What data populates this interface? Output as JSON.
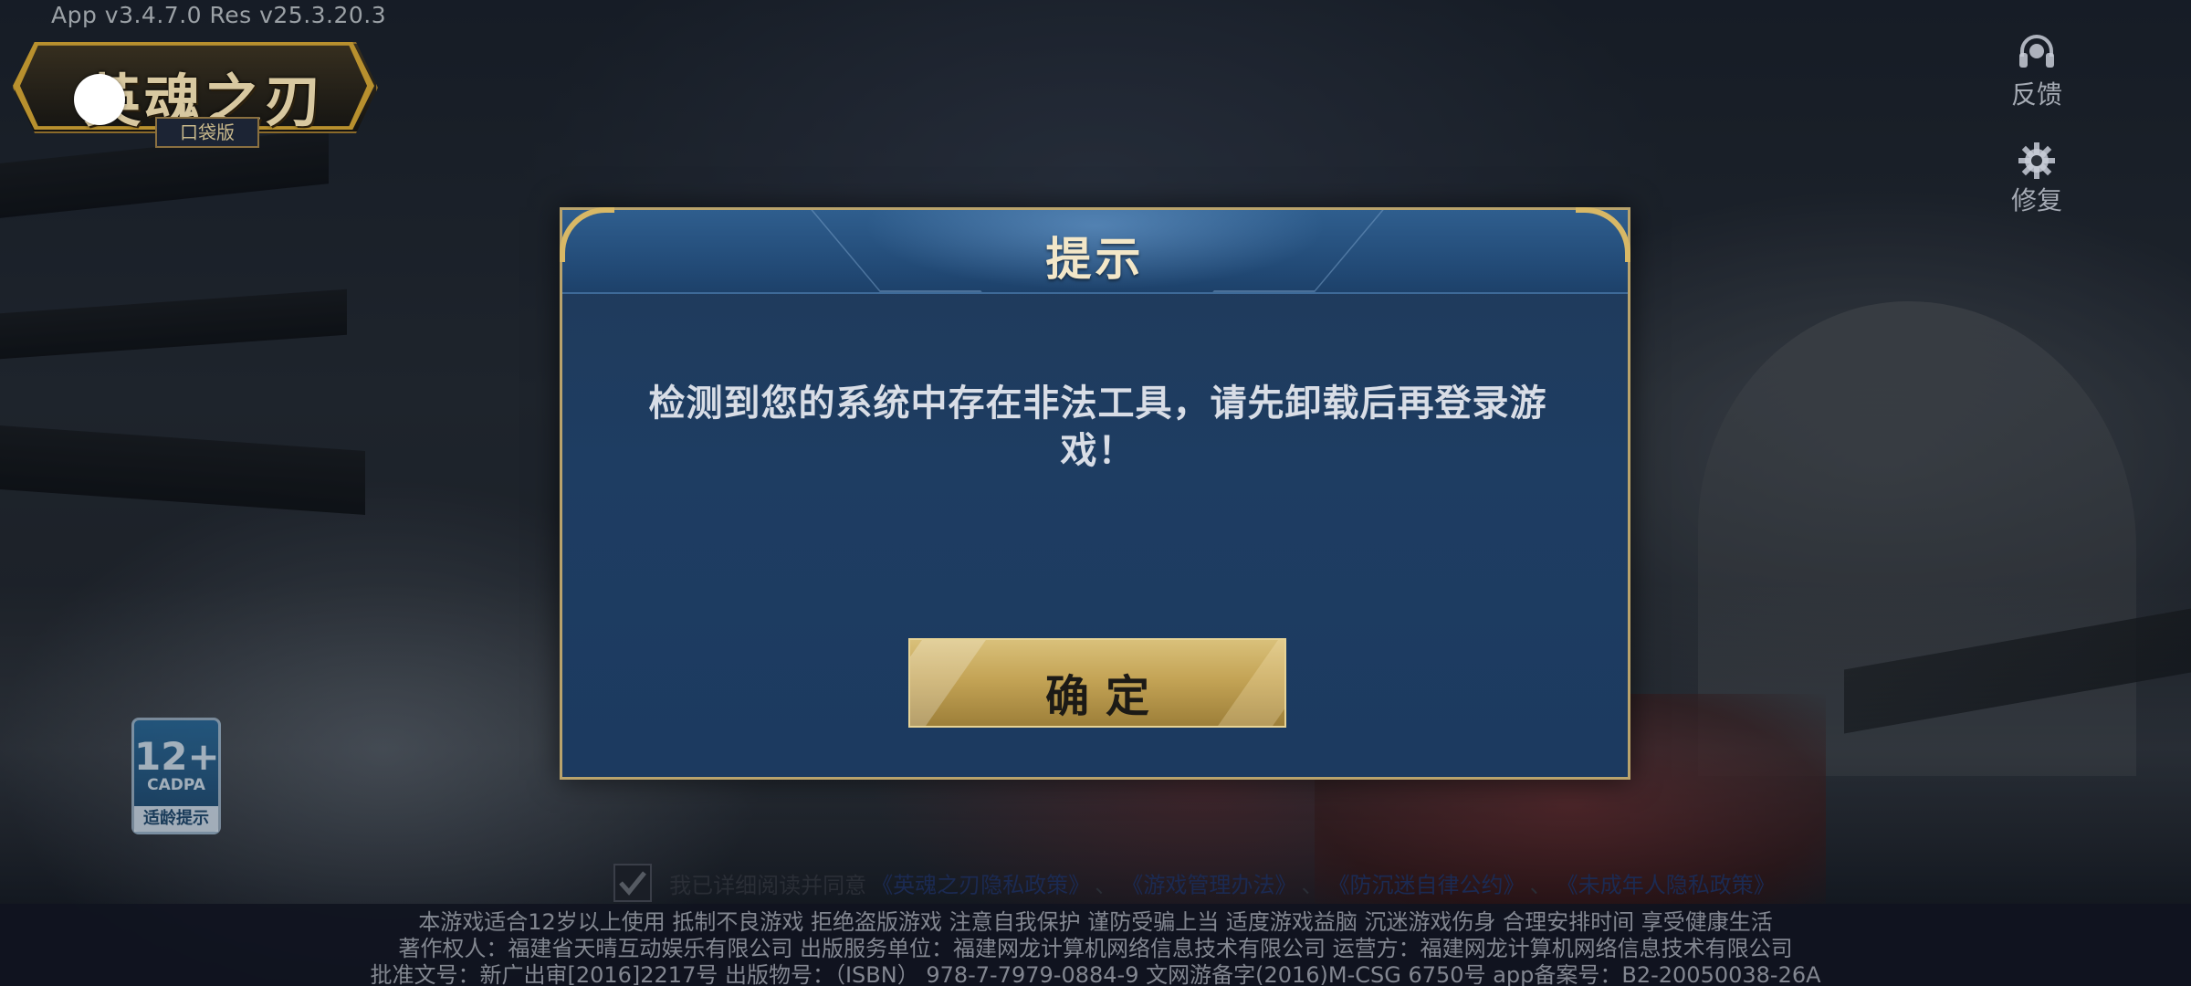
{
  "version_info": "App v3.4.7.0   Res v25.3.20.3",
  "logo": {
    "title": "英魂之刃",
    "subtitle": "口袋版"
  },
  "side_buttons": {
    "feedback": {
      "label": "反馈",
      "icon": "headset-icon"
    },
    "repair": {
      "label": "修复",
      "icon": "gear-icon"
    }
  },
  "age_rating": {
    "rating": "12+",
    "org": "CADPA",
    "tip": "适龄提示"
  },
  "dialog": {
    "title": "提示",
    "message": "检测到您的系统中存在非法工具，请先卸载后再登录游戏！",
    "confirm_label": "确定"
  },
  "agreement": {
    "checked": true,
    "prefix": "我已详细阅读并同意",
    "links": [
      "《英魂之刃隐私政策》",
      "《游戏管理办法》",
      "《防沉迷自律公约》",
      "《未成年人隐私政策》"
    ],
    "separator": "、"
  },
  "footer": {
    "line1": "本游戏适合12岁以上使用 抵制不良游戏 拒绝盗版游戏 注意自我保护 谨防受骗上当 适度游戏益脑 沉迷游戏伤身 合理安排时间 享受健康生活",
    "line2": "著作权人：福建省天晴互动娱乐有限公司 出版服务单位：福建网龙计算机网络信息技术有限公司 运营方：福建网龙计算机网络信息技术有限公司",
    "line3": "批准文号：新广出审[2016]2217号 出版物号：（ISBN） 978-7-7979-0884-9 文网游备字(2016)M-CSG 6750号 app备案号：B2-20050038-26A"
  },
  "colors": {
    "dialog_border": "#b9a36c",
    "dialog_bg": "#1e3d62",
    "button_gold": "#c4a456",
    "title_text": "#f3e7c8"
  }
}
